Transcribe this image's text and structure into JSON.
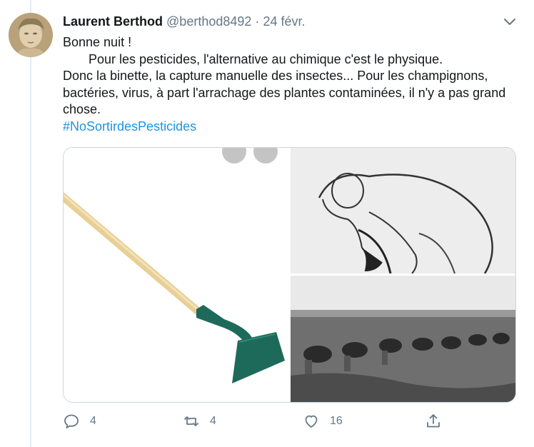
{
  "tweet": {
    "display_name": "Laurent Berthod",
    "handle": "@berthod8492",
    "separator": "·",
    "date": "24 févr.",
    "lines": [
      "Bonne nuit !",
      "Pour les pesticides, l'alternative au chimique c'est le physique.",
      "Donc la binette, la capture manuelle des insectes... Pour les champignons, bactéries, virus, à part l'arrachage des plantes contaminées, il n'y a pas grand chose."
    ],
    "hashtag": "#NoSortirdesPesticides"
  },
  "icons": {
    "caret": "chevron-down-icon",
    "reply": "reply-icon",
    "retweet": "retweet-icon",
    "like": "heart-icon",
    "share": "share-icon"
  },
  "actions": {
    "reply_count": "4",
    "retweet_count": "4",
    "like_count": "16"
  },
  "colors": {
    "link": "#1b95e0",
    "muted": "#657786",
    "hoe_green": "#1e6a5a",
    "handle_wood": "#e6c98f"
  }
}
